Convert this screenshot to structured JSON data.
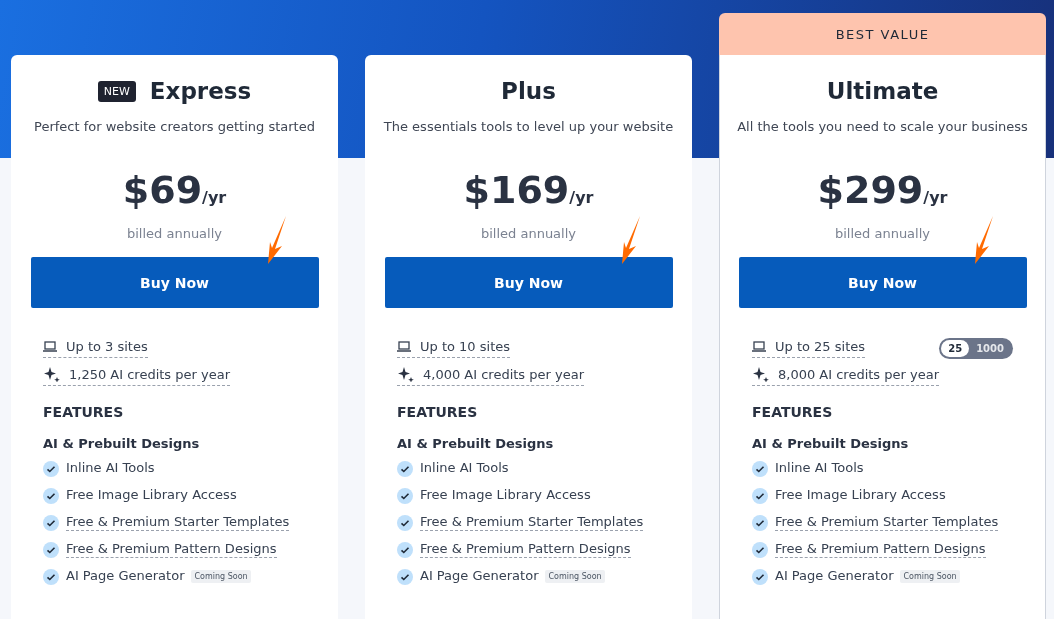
{
  "plans": [
    {
      "badge": "NEW",
      "name": "Express",
      "tagline": "Perfect for website creators getting started",
      "price": "$69",
      "period": "/yr",
      "billing": "billed annually",
      "button": "Buy Now",
      "sites": "Up to 3 sites",
      "credits": "1,250 AI credits per year",
      "features_heading": "FEATURES",
      "group": "AI & Prebuilt Designs",
      "features": [
        {
          "text": "Inline AI Tools",
          "underlined": false
        },
        {
          "text": "Free Image Library Access",
          "underlined": false
        },
        {
          "text": "Free & Premium Starter Templates",
          "underlined": true
        },
        {
          "text": "Free & Premium Pattern Designs",
          "underlined": true
        },
        {
          "text": "AI Page Generator",
          "underlined": false,
          "tag": "Coming Soon"
        }
      ]
    },
    {
      "name": "Plus",
      "tagline": "The essentials tools to level up your website",
      "price": "$169",
      "period": "/yr",
      "billing": "billed annually",
      "button": "Buy Now",
      "sites": "Up to 10 sites",
      "credits": "4,000 AI credits per year",
      "features_heading": "FEATURES",
      "group": "AI & Prebuilt Designs",
      "features": [
        {
          "text": "Inline AI Tools",
          "underlined": false
        },
        {
          "text": "Free Image Library Access",
          "underlined": false
        },
        {
          "text": "Free & Premium Starter Templates",
          "underlined": true
        },
        {
          "text": "Free & Premium Pattern Designs",
          "underlined": true
        },
        {
          "text": "AI Page Generator",
          "underlined": false,
          "tag": "Coming Soon"
        }
      ]
    },
    {
      "banner": "BEST VALUE",
      "name": "Ultimate",
      "tagline": "All the tools you need to scale your business",
      "price": "$299",
      "period": "/yr",
      "billing": "billed annually",
      "button": "Buy Now",
      "sites": "Up to 25 sites",
      "site_options": [
        {
          "label": "25",
          "selected": true
        },
        {
          "label": "1000",
          "selected": false
        }
      ],
      "credits": "8,000 AI credits per year",
      "features_heading": "FEATURES",
      "group": "AI & Prebuilt Designs",
      "features": [
        {
          "text": "Inline AI Tools",
          "underlined": false
        },
        {
          "text": "Free Image Library Access",
          "underlined": false
        },
        {
          "text": "Free & Premium Starter Templates",
          "underlined": true
        },
        {
          "text": "Free & Premium Pattern Designs",
          "underlined": true
        },
        {
          "text": "AI Page Generator",
          "underlined": false,
          "tag": "Coming Soon"
        }
      ]
    }
  ]
}
